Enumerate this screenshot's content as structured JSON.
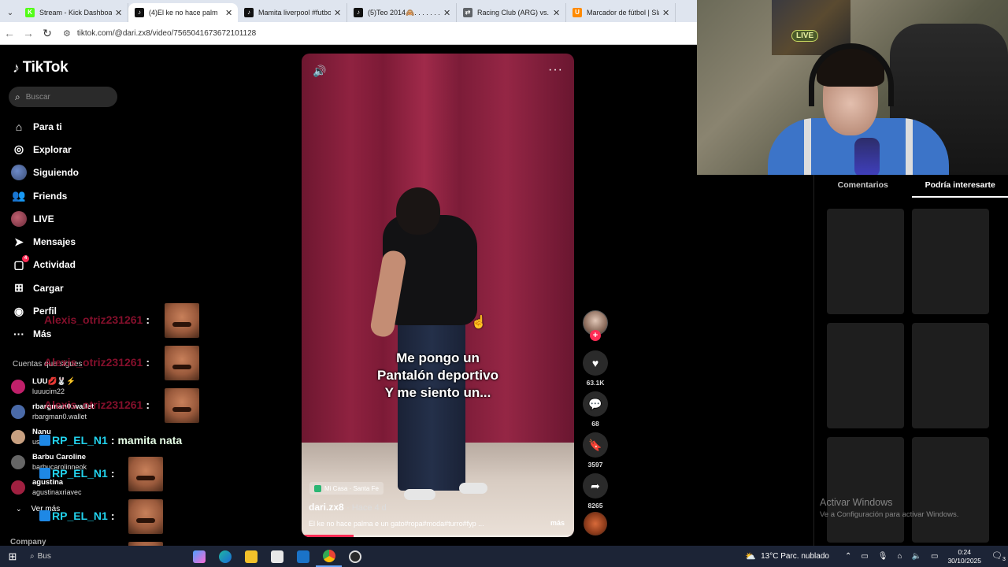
{
  "browser": {
    "tabs": [
      {
        "title": "Stream - Kick Dashboard",
        "fav_color": "#53fc18",
        "fav_glyph": "K"
      },
      {
        "title": "(4)El ke no hace palm",
        "fav_color": "#111111",
        "fav_glyph": "♪",
        "active": true
      },
      {
        "title": "Mamita liverpool #futbol",
        "fav_color": "#111111",
        "fav_glyph": "♪"
      },
      {
        "title": "(5)Teo 2014🙈. . . . . . . . .",
        "fav_color": "#111111",
        "fav_glyph": "♪"
      },
      {
        "title": "Racing Club (ARG) vs. Fla",
        "fav_color": "#5f6368",
        "fav_glyph": "⇄"
      },
      {
        "title": "Marcador de fútbol | Slan",
        "fav_color": "#ff8a00",
        "fav_glyph": "U"
      }
    ],
    "url": "tiktok.com/@dari.zx8/video/7565041673672101128"
  },
  "sidebar": {
    "logo": "TikTok",
    "search_placeholder": "Buscar",
    "nav": [
      {
        "label": "Para ti",
        "icon": "home-icon"
      },
      {
        "label": "Explorar",
        "icon": "compass-icon"
      },
      {
        "label": "Siguiendo",
        "icon": "following-avatar-icon"
      },
      {
        "label": "Friends",
        "icon": "friends-icon"
      },
      {
        "label": "LIVE",
        "icon": "live-icon"
      },
      {
        "label": "Mensajes",
        "icon": "messages-icon"
      },
      {
        "label": "Actividad",
        "icon": "activity-icon",
        "badge": "4"
      },
      {
        "label": "Cargar",
        "icon": "upload-icon"
      },
      {
        "label": "Perfil",
        "icon": "profile-icon"
      },
      {
        "label": "Más",
        "icon": "more-icon"
      }
    ],
    "following_title": "Cuentas que sigues",
    "following": [
      {
        "name": "LUU💋🐰⚡",
        "handle": "luuucim22",
        "color": "#c0206a"
      },
      {
        "name": "rbargman0.wallet",
        "handle": "rbargman0.wallet",
        "color": "#4a6aa8"
      },
      {
        "name": "Nanu",
        "handle": "us",
        "color": "#c8a080"
      },
      {
        "name": "Barbu Caroline",
        "handle": "barbucarolinneok",
        "color": "#666666"
      },
      {
        "name": "agustina",
        "handle": "agustinaxriavec",
        "color": "#a02040"
      }
    ],
    "ver_mas": "Ver más",
    "company": "Company"
  },
  "chat": [
    {
      "user": "Alexis_otriz231261",
      "msg": ""
    },
    {
      "user": "Alexis_otriz231261",
      "msg": ""
    },
    {
      "user": "Alexis_otriz231261",
      "msg": ""
    },
    {
      "user": "RP_EL_N1",
      "msg": "mamita nata"
    },
    {
      "user": "RP_EL_N1",
      "msg": ""
    },
    {
      "user": "RP_EL_N1",
      "msg": ""
    },
    {
      "user": "RP_EL_N1",
      "msg": ""
    }
  ],
  "video": {
    "caption": [
      "Me pongo un",
      "Pantalón deportivo",
      "Y me siento un..."
    ],
    "location": "Mi Casa · Santa Fe",
    "author": "dari.zx8",
    "time": "· Hace 4 d",
    "description": "El ke no hace palma e un gato#ropa#moda#turro#fyp ...",
    "more": "más",
    "progress": 0.19
  },
  "actions": {
    "likes": "63.1K",
    "comments": "68",
    "saves": "3597",
    "shares": "8265"
  },
  "panel": {
    "tabs": [
      "Comentarios",
      "Podría interesarte"
    ],
    "active_tab": 1
  },
  "webcam": {
    "badge": "LIVE"
  },
  "watermark": {
    "line1": "Activar Windows",
    "line2": "Ve a Configuración para activar Windows."
  },
  "taskbar": {
    "search": "Bus",
    "weather": "13°C  Parc. nublado",
    "time": "0:24",
    "date": "30/10/2025",
    "notifications": "3"
  }
}
